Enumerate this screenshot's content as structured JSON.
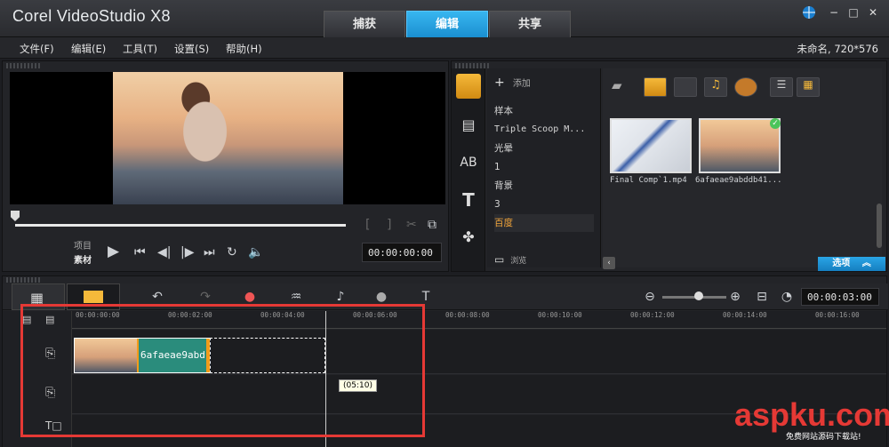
{
  "app": {
    "title": "Corel VideoStudio X8"
  },
  "steps": [
    {
      "label": "捕获"
    },
    {
      "label": "编辑"
    },
    {
      "label": "共享"
    }
  ],
  "menu": [
    {
      "label": "文件(F)"
    },
    {
      "label": "编辑(E)"
    },
    {
      "label": "工具(T)"
    },
    {
      "label": "设置(S)"
    },
    {
      "label": "帮助(H)"
    }
  ],
  "project_info": "未命名, 720*576",
  "player": {
    "mode_project": "项目",
    "mode_clip": "素材",
    "timecode": "00:00:00:00"
  },
  "library": {
    "add_label": "添加",
    "browse_label": "浏览",
    "folders": [
      {
        "label": "样本"
      },
      {
        "label": "Triple Scoop M..."
      },
      {
        "label": "光晕"
      },
      {
        "label": "1"
      },
      {
        "label": "背景"
      },
      {
        "label": "3"
      },
      {
        "label": "百度"
      }
    ],
    "selected_folder": "百度",
    "media": [
      {
        "label": "Final Comp`1.mp4"
      },
      {
        "label": "6afaeae9abddb41..."
      }
    ],
    "options_label": "选项"
  },
  "timeline": {
    "timecode": "00:00:03:00",
    "ruler": [
      "00:00:00:00",
      "00:00:02:00",
      "00:00:04:00",
      "00:00:06:00",
      "00:00:08:00",
      "00:00:10:00",
      "00:00:12:00",
      "00:00:14:00",
      "00:00:16:00"
    ],
    "clip_label": "6afaeae9abd",
    "tooltip": "(05:10)"
  },
  "watermark": {
    "main": "aspku.com",
    "sub": "免费网站源码下载站!"
  },
  "colors": {
    "accent": "#1a8fd0",
    "highlight": "#e53935",
    "clip": "#2a8c7c",
    "clip_edge": "#f29c1b"
  }
}
